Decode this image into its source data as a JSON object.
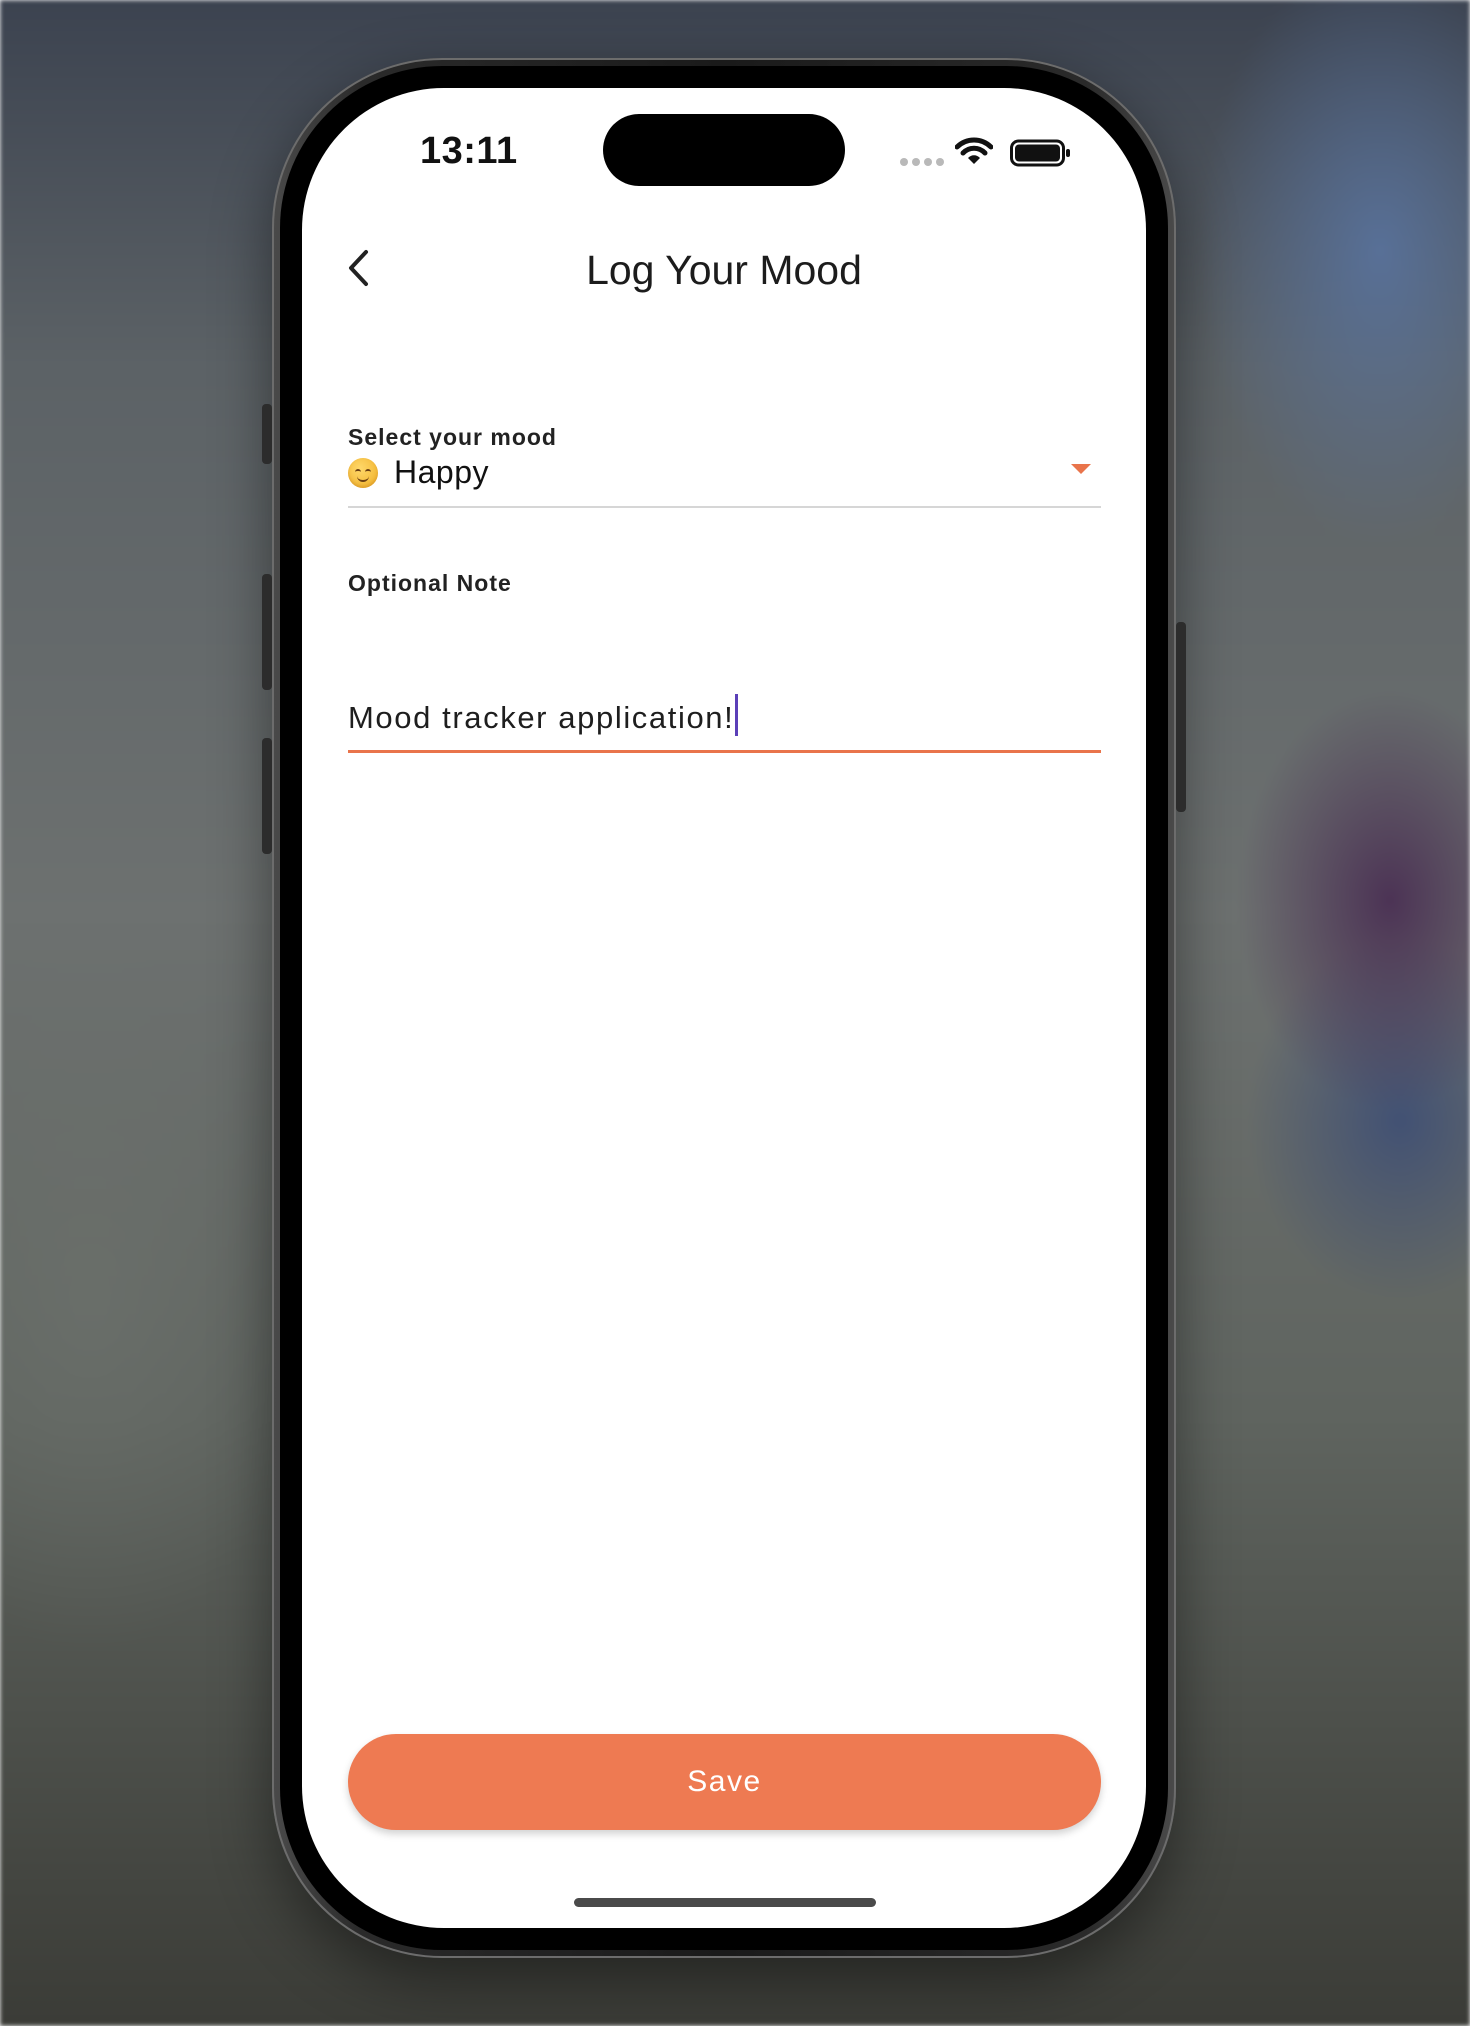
{
  "status_bar": {
    "time": "13:11",
    "wifi_icon": "wifi-icon",
    "battery_icon": "battery-full-icon"
  },
  "nav": {
    "title": "Log Your Mood",
    "back_icon": "chevron-left-icon"
  },
  "form": {
    "mood": {
      "label": "Select your mood",
      "emoji_icon": "smiling-face-icon",
      "selected_value": "Happy"
    },
    "note": {
      "label": "Optional Note",
      "value": "Mood tracker application!"
    }
  },
  "actions": {
    "save_label": "Save"
  },
  "colors": {
    "accent": "#ee7a52",
    "caret": "#5b3fb8"
  }
}
